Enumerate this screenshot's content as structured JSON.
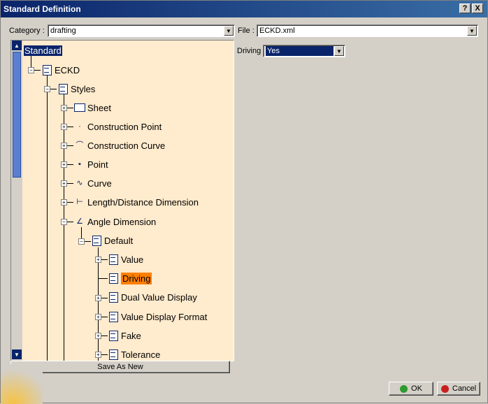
{
  "window": {
    "title": "Standard Definition",
    "help_btn": "?",
    "close_btn": "X"
  },
  "category": {
    "label": "Category :",
    "value": "drafting"
  },
  "file": {
    "label": "File :",
    "value": "ECKD.xml"
  },
  "driving": {
    "label": "Driving",
    "value": "Yes"
  },
  "tree": {
    "root": "Standard",
    "eckd": "ECKD",
    "styles": "Styles",
    "sheet": "Sheet",
    "construction_point": "Construction Point",
    "construction_curve": "Construction Curve",
    "point": "Point",
    "curve": "Curve",
    "length_distance": "Length/Distance Dimension",
    "angle_dimension": "Angle Dimension",
    "default": "Default",
    "value": "Value",
    "driving": "Driving",
    "dual_value": "Dual Value Display",
    "value_display_format": "Value Display Format",
    "fake": "Fake",
    "tolerance": "Tolerance"
  },
  "buttons": {
    "save_as_new": "Save As New",
    "ok": "OK",
    "cancel": "Cancel"
  },
  "colors": {
    "titlebar": "#0a246a",
    "tree_bg": "#ffebcd",
    "selection": "#ff7f00"
  }
}
